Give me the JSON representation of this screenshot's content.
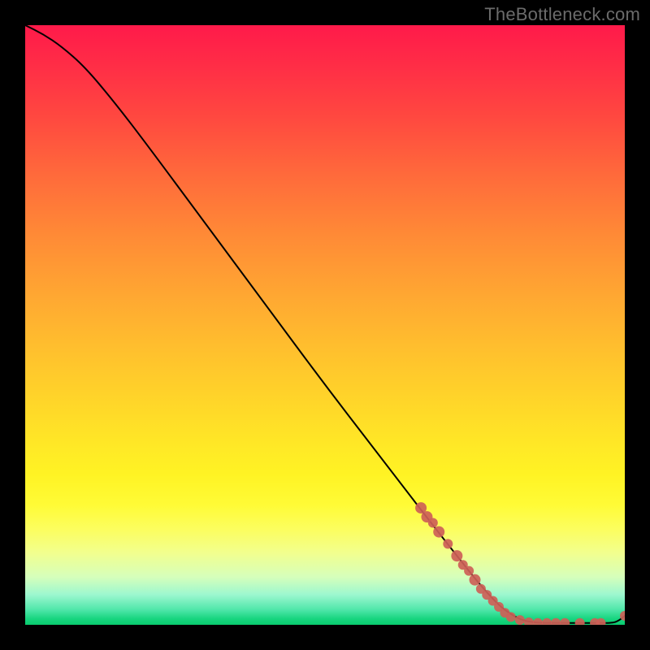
{
  "watermark": "TheBottleneck.com",
  "colors": {
    "curve": "#000000",
    "marker_fill": "#cd5f57",
    "marker_stroke": "#cd5f57"
  },
  "chart_data": {
    "type": "line",
    "title": "",
    "xlabel": "",
    "ylabel": "",
    "xlim": [
      0,
      100
    ],
    "ylim": [
      0,
      100
    ],
    "grid": false,
    "legend": false,
    "curve": [
      {
        "x": 0,
        "y": 100
      },
      {
        "x": 3,
        "y": 98.5
      },
      {
        "x": 6,
        "y": 96.5
      },
      {
        "x": 10,
        "y": 93
      },
      {
        "x": 15,
        "y": 87
      },
      {
        "x": 20,
        "y": 80.5
      },
      {
        "x": 30,
        "y": 67
      },
      {
        "x": 40,
        "y": 53.5
      },
      {
        "x": 50,
        "y": 40
      },
      {
        "x": 60,
        "y": 27
      },
      {
        "x": 70,
        "y": 14
      },
      {
        "x": 78,
        "y": 4
      },
      {
        "x": 82,
        "y": 1
      },
      {
        "x": 85,
        "y": 0.3
      },
      {
        "x": 90,
        "y": 0.3
      },
      {
        "x": 95,
        "y": 0.3
      },
      {
        "x": 98,
        "y": 0.3
      },
      {
        "x": 99,
        "y": 0.7
      },
      {
        "x": 100,
        "y": 1.5
      }
    ],
    "markers": [
      {
        "x": 66,
        "y": 19.5,
        "r": 7
      },
      {
        "x": 67,
        "y": 18,
        "r": 7
      },
      {
        "x": 68,
        "y": 17,
        "r": 6
      },
      {
        "x": 69,
        "y": 15.5,
        "r": 7
      },
      {
        "x": 70.5,
        "y": 13.5,
        "r": 6
      },
      {
        "x": 72,
        "y": 11.5,
        "r": 7
      },
      {
        "x": 73,
        "y": 10,
        "r": 6
      },
      {
        "x": 74,
        "y": 9,
        "r": 6
      },
      {
        "x": 75,
        "y": 7.5,
        "r": 7
      },
      {
        "x": 76,
        "y": 6,
        "r": 6
      },
      {
        "x": 77,
        "y": 5,
        "r": 6
      },
      {
        "x": 78,
        "y": 4,
        "r": 6
      },
      {
        "x": 79,
        "y": 3,
        "r": 6
      },
      {
        "x": 80,
        "y": 2,
        "r": 6
      },
      {
        "x": 81,
        "y": 1.3,
        "r": 6
      },
      {
        "x": 82.5,
        "y": 0.8,
        "r": 6
      },
      {
        "x": 84,
        "y": 0.4,
        "r": 6
      },
      {
        "x": 85.5,
        "y": 0.3,
        "r": 6
      },
      {
        "x": 87,
        "y": 0.3,
        "r": 6
      },
      {
        "x": 88.5,
        "y": 0.3,
        "r": 6
      },
      {
        "x": 90,
        "y": 0.3,
        "r": 6
      },
      {
        "x": 92.5,
        "y": 0.3,
        "r": 6
      },
      {
        "x": 95,
        "y": 0.3,
        "r": 6
      },
      {
        "x": 96,
        "y": 0.3,
        "r": 6
      },
      {
        "x": 100,
        "y": 1.5,
        "r": 6
      }
    ]
  }
}
